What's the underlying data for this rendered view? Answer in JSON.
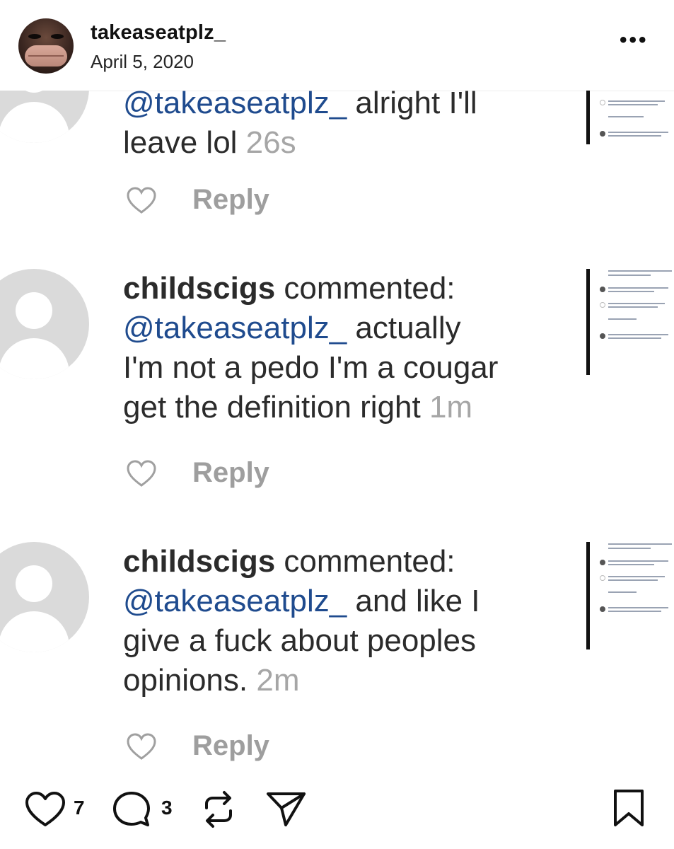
{
  "header": {
    "username": "takeaseatplz_",
    "date": "April 5, 2020",
    "more_label": "•••",
    "avatar_icon": "profile-avatar"
  },
  "comments": [
    {
      "lines": [
        [
          {
            "type": "mention",
            "text": "@takeaseatplz_"
          },
          {
            "type": "text",
            "text": " alright I'll"
          }
        ],
        [
          {
            "type": "text",
            "text": "leave lol "
          },
          {
            "type": "time",
            "text": "26s"
          }
        ]
      ],
      "reply_label": "Reply"
    },
    {
      "lines": [
        [
          {
            "type": "user",
            "text": "childscigs"
          },
          {
            "type": "text",
            "text": " commented:"
          }
        ],
        [
          {
            "type": "mention",
            "text": "@takeaseatplz_"
          },
          {
            "type": "text",
            "text": " actually"
          }
        ],
        [
          {
            "type": "text",
            "text": "I'm not a pedo I'm a cougar"
          }
        ],
        [
          {
            "type": "text",
            "text": "get the definition right "
          },
          {
            "type": "time",
            "text": "1m"
          }
        ]
      ],
      "reply_label": "Reply"
    },
    {
      "lines": [
        [
          {
            "type": "user",
            "text": "childscigs"
          },
          {
            "type": "text",
            "text": " commented:"
          }
        ],
        [
          {
            "type": "mention",
            "text": "@takeaseatplz_"
          },
          {
            "type": "text",
            "text": " and like I"
          }
        ],
        [
          {
            "type": "text",
            "text": "give a fuck about peoples"
          }
        ],
        [
          {
            "type": "text",
            "text": "opinions. "
          },
          {
            "type": "time",
            "text": "2m"
          }
        ]
      ],
      "reply_label": "Reply"
    }
  ],
  "actions": {
    "like_count": "7",
    "comment_count": "3",
    "icons": [
      "heart-icon",
      "comment-icon",
      "repost-icon",
      "share-icon",
      "bookmark-icon"
    ]
  },
  "colors": {
    "mention": "#1f4b8e",
    "timestamp": "#a6a6a6",
    "reply": "#9e9e9e"
  }
}
